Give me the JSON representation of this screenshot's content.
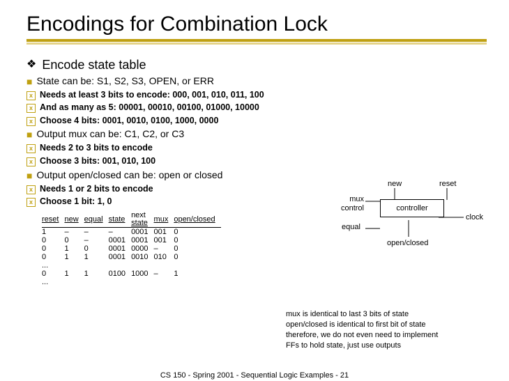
{
  "title": "Encodings for Combination Lock",
  "bullets": {
    "b1": "Encode state table",
    "b1a": "State can be: S1, S2, S3, OPEN, or ERR",
    "b1a_i": "Needs at least 3 bits to encode: 000, 001, 010, 011, 100",
    "b1a_ii": "And as many as 5: 00001, 00010, 00100, 01000, 10000",
    "b1a_iii": "Choose 4 bits: 0001, 0010, 0100, 1000, 0000",
    "b1b": "Output mux can be: C1, C2, or C3",
    "b1b_i": "Needs 2 to 3 bits to encode",
    "b1b_ii": "Choose 3 bits: 001, 010, 100",
    "b1c": "Output open/closed can be: open or closed",
    "b1c_i": "Needs 1 or 2 bits to encode",
    "b1c_ii": "Choose 1 bit: 1, 0"
  },
  "table": {
    "headers": {
      "reset": "reset",
      "new": "new",
      "equal": "equal",
      "state": "state",
      "next_l1": "next",
      "next_l2": "state",
      "mux": "mux",
      "oc": "open/closed"
    },
    "rows": [
      {
        "reset": "1",
        "new": "–",
        "equal": "–",
        "state": "–",
        "next": "0001",
        "mux": "001",
        "oc": "0"
      },
      {
        "reset": "0",
        "new": "0",
        "equal": "–",
        "state": "0001",
        "next": "0001",
        "mux": "001",
        "oc": "0"
      },
      {
        "reset": "0",
        "new": "1",
        "equal": "0",
        "state": "0001",
        "next": "0000",
        "mux": "–",
        "oc": "0"
      },
      {
        "reset": "0",
        "new": "1",
        "equal": "1",
        "state": "0001",
        "next": "0010",
        "mux": "010",
        "oc": "0"
      },
      {
        "reset": "...",
        "new": "",
        "equal": "",
        "state": "",
        "next": "",
        "mux": "",
        "oc": ""
      },
      {
        "reset": "0",
        "new": "1",
        "equal": "1",
        "state": "0100",
        "next": "1000",
        "mux": "–",
        "oc": "1"
      },
      {
        "reset": "...",
        "new": "",
        "equal": "",
        "state": "",
        "next": "",
        "mux": "",
        "oc": ""
      }
    ]
  },
  "diagram": {
    "new": "new",
    "reset": "reset",
    "mux_l1": "mux",
    "mux_l2": "control",
    "controller": "controller",
    "equal": "equal",
    "clock": "clock",
    "oc": "open/closed"
  },
  "notes": {
    "l1": "mux is identical to last 3 bits of state",
    "l2": "open/closed is identical to first bit of state",
    "l3": "therefore, we do not even need to implement",
    "l4": "FFs to hold state, just use outputs"
  },
  "footer": "CS 150 - Spring 2001 - Sequential Logic Examples - 21"
}
